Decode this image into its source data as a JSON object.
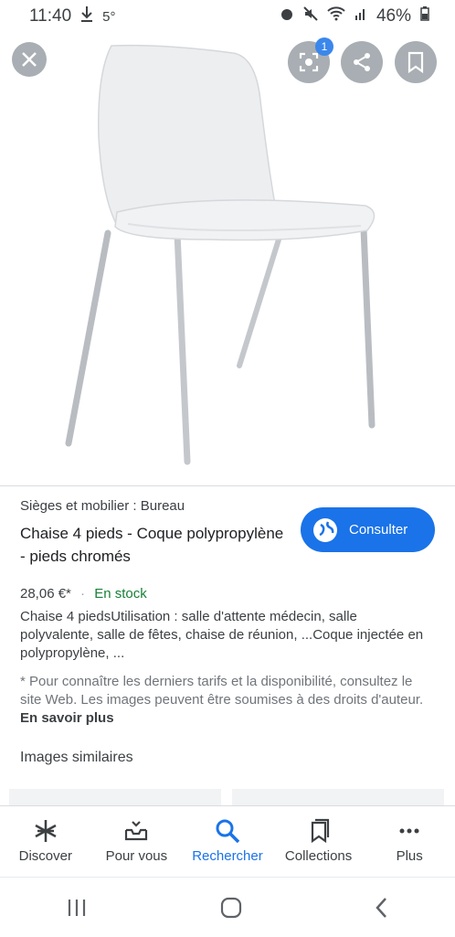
{
  "status_bar": {
    "time": "11:40",
    "temp": "5°",
    "battery": "46%"
  },
  "product_image": {
    "icon": "chair-icon"
  },
  "overlay": {
    "lens_badge": "1"
  },
  "product": {
    "category": "Sièges et mobilier : Bureau",
    "title": "Chaise 4 pieds - Coque polypropylène - pieds chromés",
    "price": "28,06 €*",
    "separator": " · ",
    "stock": "En stock",
    "description": "Chaise 4 piedsUtilisation : salle d'attente médecin, salle polyvalente, salle de fêtes, chaise de réunion, ...Coque injectée en polypropylène, ...",
    "disclaimer": "* Pour connaître les derniers tarifs et la disponibilité, consultez le site Web. Les images peuvent être soumises à des droits d'auteur.",
    "learn_more": "En savoir plus"
  },
  "consult_button": {
    "label": "Consulter"
  },
  "similar_images": {
    "label": "Images similaires"
  },
  "bottom_nav": [
    {
      "label": "Discover",
      "icon": "asterisk-icon"
    },
    {
      "label": "Pour vous",
      "icon": "inbox-icon"
    },
    {
      "label": "Rechercher",
      "icon": "search-icon"
    },
    {
      "label": "Collections",
      "icon": "collections-icon"
    },
    {
      "label": "Plus",
      "icon": "more-icon"
    }
  ],
  "colors": {
    "accent": "#1a73e8",
    "stock": "#188038"
  }
}
